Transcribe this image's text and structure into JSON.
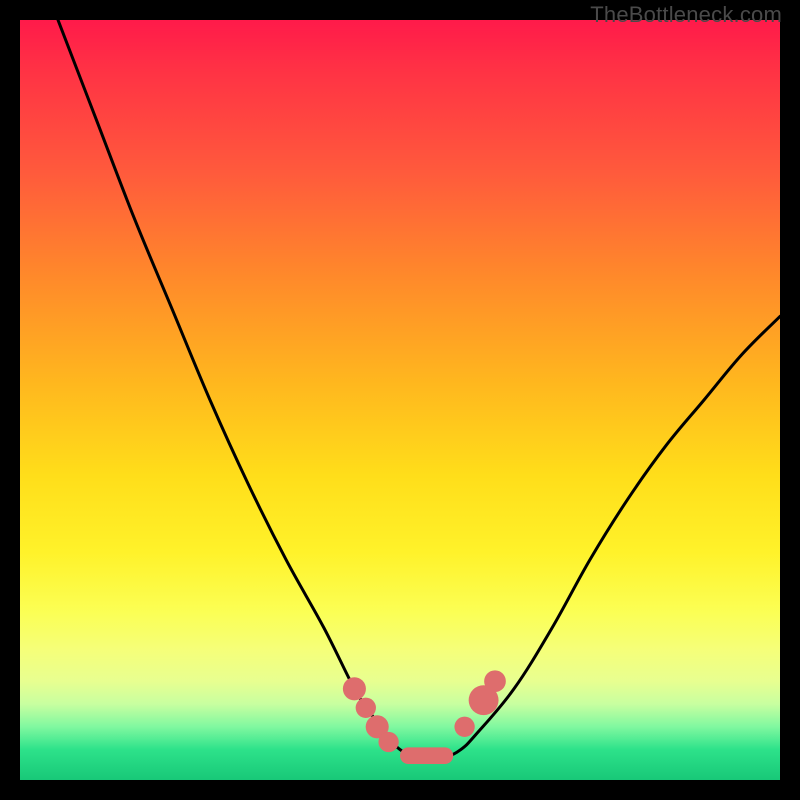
{
  "watermark": "TheBottleneck.com",
  "chart_data": {
    "type": "line",
    "title": "",
    "xlabel": "",
    "ylabel": "",
    "xlim": [
      0,
      100
    ],
    "ylim": [
      0,
      100
    ],
    "grid": false,
    "legend": false,
    "series": [
      {
        "name": "bottleneck-curve",
        "color": "#000000",
        "x": [
          5,
          10,
          15,
          20,
          25,
          30,
          35,
          40,
          44,
          46,
          48,
          50,
          52,
          54,
          56,
          58,
          60,
          65,
          70,
          75,
          80,
          85,
          90,
          95,
          100
        ],
        "y": [
          100,
          87,
          74,
          62,
          50,
          39,
          29,
          20,
          12,
          9,
          6,
          4,
          3,
          3,
          3,
          4,
          6,
          12,
          20,
          29,
          37,
          44,
          50,
          56,
          61
        ]
      }
    ],
    "markers": {
      "name": "valley-markers",
      "color": "#de6d6d",
      "points": [
        {
          "x": 44.0,
          "y": 12.0,
          "r": 1.1
        },
        {
          "x": 45.5,
          "y": 9.5,
          "r": 0.9
        },
        {
          "x": 47.0,
          "y": 7.0,
          "r": 1.1
        },
        {
          "x": 48.5,
          "y": 5.0,
          "r": 0.9
        },
        {
          "x": 58.5,
          "y": 7.0,
          "r": 0.9
        },
        {
          "x": 61.0,
          "y": 10.5,
          "r": 1.6
        },
        {
          "x": 62.5,
          "y": 13.0,
          "r": 1.0
        }
      ],
      "bar": {
        "x0": 50.0,
        "x1": 57.0,
        "y": 3.2,
        "thickness": 2.2
      }
    },
    "background_gradient": {
      "top": "#ff1a4a",
      "middle": "#ffde1a",
      "bottom": "#18c878"
    }
  }
}
